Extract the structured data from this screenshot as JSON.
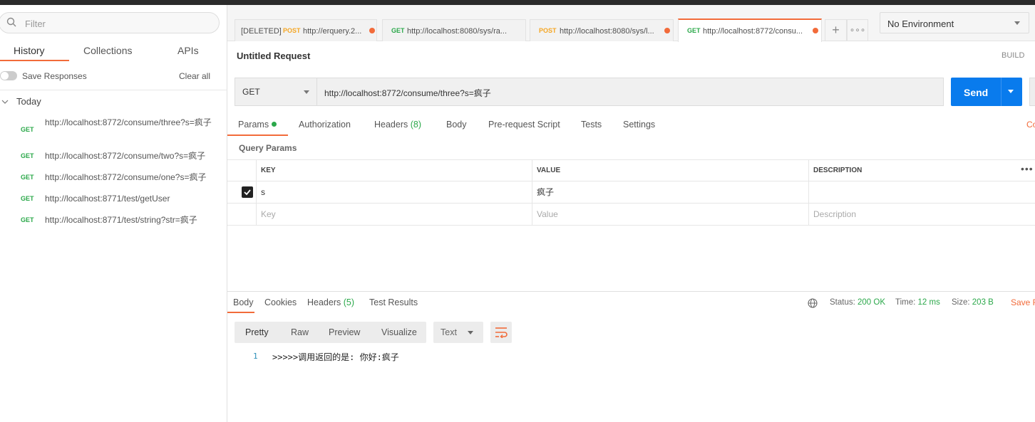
{
  "sidebar": {
    "filter_placeholder": "Filter",
    "tabs": [
      {
        "label": "History",
        "active": true
      },
      {
        "label": "Collections",
        "active": false
      },
      {
        "label": "APIs",
        "active": false
      }
    ],
    "save_responses_label": "Save Responses",
    "clear_all_label": "Clear all",
    "group_label": "Today",
    "history": [
      {
        "method": "GET",
        "url": "http://localhost:8772/consume/three?s=疯子"
      },
      {
        "method": "GET",
        "url": "http://localhost:8772/consume/two?s=疯子"
      },
      {
        "method": "GET",
        "url": "http://localhost:8772/consume/one?s=疯子"
      },
      {
        "method": "GET",
        "url": "http://localhost:8771/test/getUser"
      },
      {
        "method": "GET",
        "url": "http://localhost:8771/test/string?str=疯子"
      }
    ]
  },
  "tabs": [
    {
      "prefix": "[DELETED]",
      "method": "POST",
      "title": "http://erquery.2...",
      "unsaved": true
    },
    {
      "prefix": "",
      "method": "GET",
      "title": "http://localhost:8080/sys/ra...",
      "unsaved": false
    },
    {
      "prefix": "",
      "method": "POST",
      "title": "http://localhost:8080/sys/l...",
      "unsaved": true
    },
    {
      "prefix": "",
      "method": "GET",
      "title": "http://localhost:8772/consu...",
      "unsaved": true,
      "active": true
    }
  ],
  "tab_plus": "+",
  "tab_more": "∘∘∘",
  "environment": {
    "selected": "No Environment"
  },
  "request": {
    "title": "Untitled Request",
    "build_label": "BUILD",
    "method": "GET",
    "url": "http://localhost:8772/consume/three?s=疯子",
    "send_label": "Send",
    "tabs": [
      {
        "label": "Params",
        "count": "",
        "active": true
      },
      {
        "label": "Authorization",
        "count": ""
      },
      {
        "label": "Headers",
        "count": "(8)"
      },
      {
        "label": "Body",
        "count": ""
      },
      {
        "label": "Pre-request Script",
        "count": ""
      },
      {
        "label": "Tests",
        "count": ""
      },
      {
        "label": "Settings",
        "count": ""
      }
    ],
    "cookies_label": "Co",
    "query_params_title": "Query Params",
    "table": {
      "headers": [
        "KEY",
        "VALUE",
        "DESCRIPTION"
      ],
      "rows": [
        {
          "checked": true,
          "key": "s",
          "value": "疯子",
          "description": ""
        }
      ],
      "placeholder": {
        "key": "Key",
        "value": "Value",
        "description": "Description"
      },
      "more": "•••"
    }
  },
  "response": {
    "tabs": [
      {
        "label": "Body",
        "count": "",
        "active": true
      },
      {
        "label": "Cookies",
        "count": ""
      },
      {
        "label": "Headers",
        "count": "(5)"
      },
      {
        "label": "Test Results",
        "count": ""
      }
    ],
    "status_label": "Status:",
    "status_value": "200 OK",
    "time_label": "Time:",
    "time_value": "12 ms",
    "size_label": "Size:",
    "size_value": "203 B",
    "save_label": "Save R",
    "formats": [
      "Pretty",
      "Raw",
      "Preview",
      "Visualize"
    ],
    "active_format": "Pretty",
    "type": "Text",
    "lines": [
      {
        "num": "1",
        "text": ">>>>>调用返回的是: 你好:疯子"
      }
    ]
  },
  "colors": {
    "accent": "#f26b3a",
    "send": "#097bed",
    "get": "#2ba84a",
    "post": "#f5a623"
  }
}
